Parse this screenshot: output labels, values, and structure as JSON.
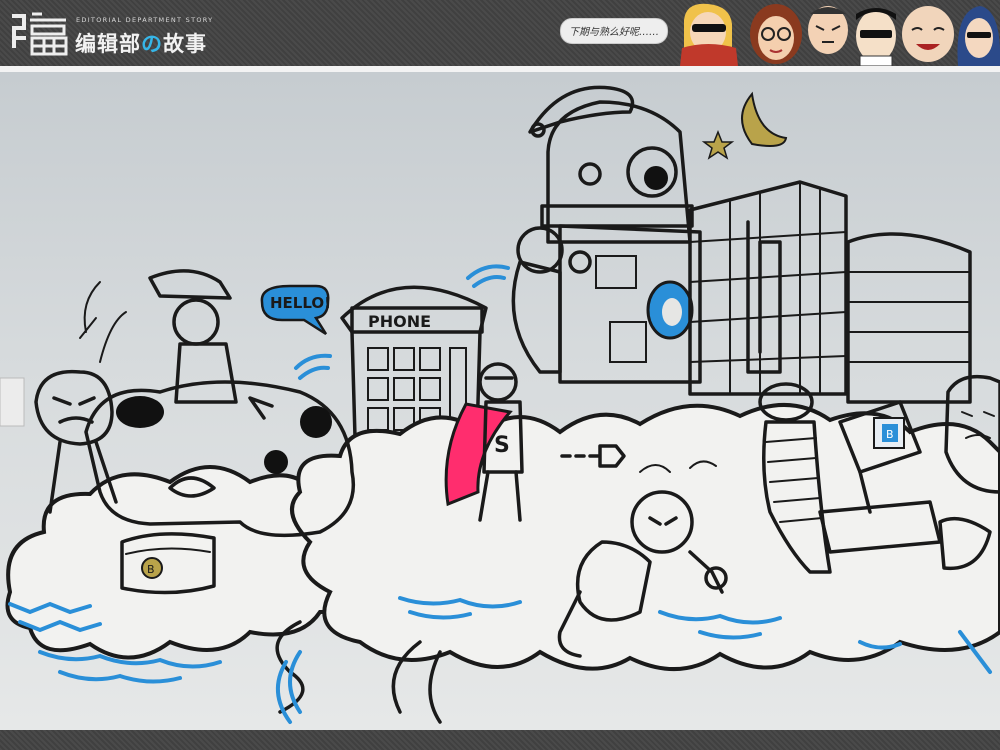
{
  "header": {
    "logo_glyph": "编",
    "logo_subtitle": "EDITORIAL DEPARTMENT STORY",
    "logo_title_part1": "编辑部",
    "logo_title_accent": "の",
    "logo_title_part2": "故事",
    "speech_bubble": "下期与熟么好呢……",
    "character_icons": [
      "sunglasses-scarf-face",
      "woman-glasses-face",
      "angry-face",
      "sunglasses-man-face",
      "bald-laughing-face",
      "long-hair-woman-face"
    ]
  },
  "mural": {
    "hello_sign": "HELLO!",
    "booth_sign": "PHONE",
    "hero_emblem": "S",
    "chest_coin": "B",
    "monitor_letter": "B",
    "colors": {
      "accent_blue": "#2a8fd8",
      "cape_pink": "#ff2d6e",
      "moon_gold": "#b9a34a",
      "ink": "#1a1a1a"
    }
  }
}
